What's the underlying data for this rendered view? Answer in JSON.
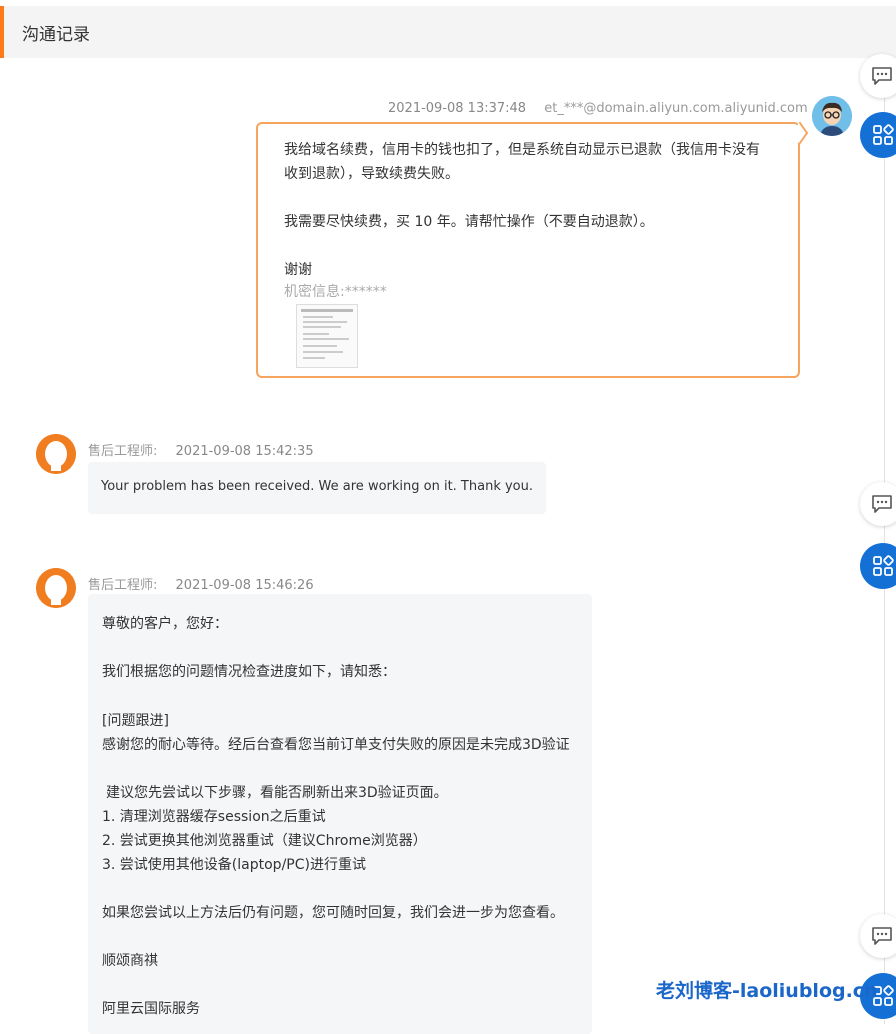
{
  "header": {
    "title": "沟通记录"
  },
  "messages": [
    {
      "time": "2021-09-08 13:37:48",
      "sender": "et_***@domain.aliyun.com.aliyunid.com",
      "lines": [
        "我给域名续费，信用卡的钱也扣了，但是系统自动显示已退款（我信用卡没有",
        "收到退款），导致续费失败。",
        "我需要尽快续费，买 10 年。请帮忙操作（不要自动退款）。",
        "谢谢"
      ],
      "confidential": "机密信息:******"
    },
    {
      "role": "售后工程师:",
      "time": "2021-09-08 15:42:35",
      "text": "Your problem has been received. We are working on it. Thank you."
    },
    {
      "role": "售后工程师:",
      "time": "2021-09-08 15:46:26",
      "lines": [
        "尊敬的客户，您好：",
        "我们根据您的问题情况检查进度如下，请知悉：",
        "[问题跟进]",
        "感谢您的耐心等待。经后台查看您当前订单支付失败的原因是未完成3D验证",
        "建议您先尝试以下步骤，看能否刷新出来3D验证页面。",
        "1. 清理浏览器缓存session之后重试",
        "2. 尝试更换其他浏览器重试（建议Chrome浏览器）",
        "3. 尝试使用其他设备(laptop/PC)进行重试",
        "如果您尝试以上方法后仍有问题，您可随时回复，我们会进一步为您查看。",
        "顺颂商祺",
        "阿里云国际服务"
      ]
    }
  ],
  "watermark": "老刘博客-laoliublog.cn",
  "colors": {
    "accent": "#ff7a1a",
    "bubble_border": "#f5a55d",
    "blue": "#1570d6"
  },
  "icons": [
    "chat-bubble-icon",
    "apps-grid-icon"
  ]
}
